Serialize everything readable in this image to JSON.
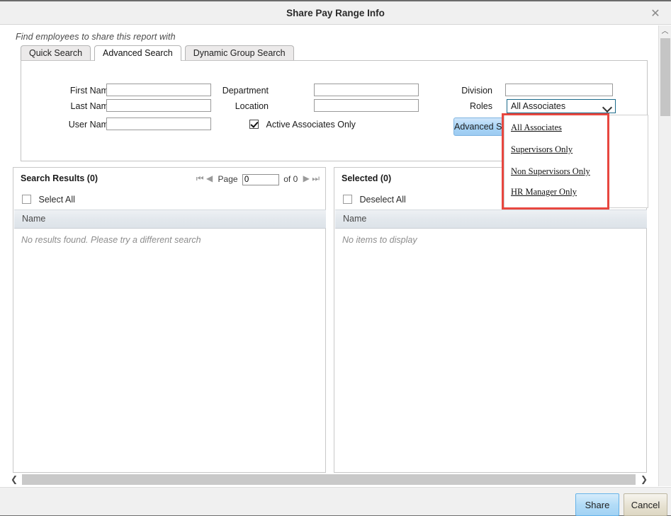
{
  "window": {
    "title": "Share Pay Range Info",
    "close_icon": "close-icon"
  },
  "hint": "Find employees to share this report with",
  "tabs": [
    {
      "label": "Quick Search",
      "active": false
    },
    {
      "label": "Advanced Search",
      "active": true
    },
    {
      "label": "Dynamic Group Search",
      "active": false
    }
  ],
  "criteria": {
    "fields": [
      {
        "label": "First Name",
        "value": "",
        "name": "first-name"
      },
      {
        "label": "Last Name",
        "value": "",
        "name": "last-name"
      },
      {
        "label": "User Name",
        "value": "",
        "name": "user-name"
      },
      {
        "label": "Department",
        "value": "",
        "name": "department"
      },
      {
        "label": "Location",
        "value": "",
        "name": "location"
      },
      {
        "label": "Division",
        "value": "",
        "name": "division"
      }
    ],
    "checkbox": {
      "label": "Active Associates Only",
      "checked": true
    },
    "roles": {
      "label": "Roles",
      "selected": "All Associates",
      "options": [
        "All Associates",
        "Supervisors Only",
        "Non Supervisors Only",
        "HR Manager Only"
      ]
    },
    "advanced_button": "Advanced Search"
  },
  "results_panel": {
    "title": "Search Results (0)",
    "select_all": "Select All",
    "column_header": "Name",
    "empty_message": "No results found. Please try a different search",
    "pager": {
      "first_icon": "⏮",
      "prev_icon": "◀",
      "page_label": "Page",
      "page_value": "0",
      "of_label": "of 0",
      "next_icon": "▶",
      "last_icon": "⏭"
    }
  },
  "selected_panel": {
    "title": "Selected (0)",
    "deselect_all": "Deselect All",
    "column_header": "Name",
    "empty_message": "No items to display"
  },
  "scrollbars": {
    "v_up_icon": "︿",
    "h_left_icon": "❮",
    "h_right_icon": "❯"
  },
  "footer": {
    "share": "Share",
    "cancel": "Cancel"
  },
  "colors": {
    "accent_blue": "#a9d4f5",
    "highlight_red": "#e8473f",
    "titlebar": "#f0f0f0"
  }
}
